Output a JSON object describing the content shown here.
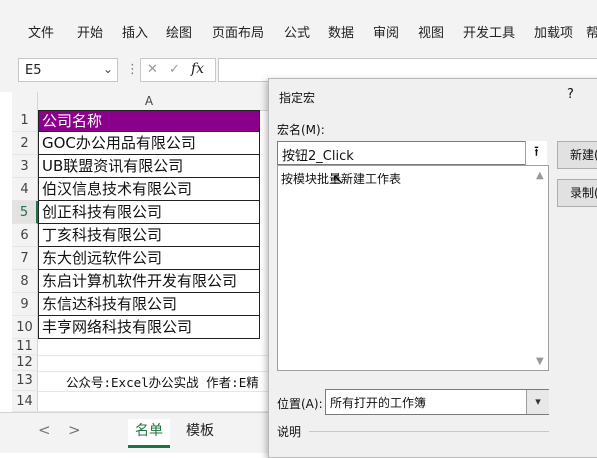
{
  "ribbon": {
    "tabs": [
      "文件",
      "开始",
      "插入",
      "绘图",
      "页面布局",
      "公式",
      "数据",
      "审阅",
      "视图",
      "开发工具",
      "加载项",
      "帮"
    ]
  },
  "formula_bar": {
    "name_box": "E5",
    "sep": "⋮",
    "cancel": "✕",
    "enter": "✓",
    "fx": "fx",
    "formula": ""
  },
  "grid": {
    "column_header": "A",
    "rows": [
      "1",
      "2",
      "3",
      "4",
      "5",
      "6",
      "7",
      "8",
      "9",
      "10",
      "11",
      "12",
      "13",
      "14"
    ],
    "selected_row": "5",
    "cells": [
      "公司名称",
      "GOC办公用品有限公司",
      "UB联盟资讯有限公司",
      "伯汉信息技术有限公司",
      "创正科技有限公司",
      "丁亥科技有限公司",
      "东大创远软件公司",
      "东启计算机软件开发有限公司",
      "东信达科技有限公司",
      "丰亨网络科技有限公司"
    ],
    "footer_text": "公众号:Excel办公实战 作者:E精"
  },
  "sheets": {
    "prev": "<",
    "next": ">",
    "tabs": [
      "名单",
      "模板"
    ],
    "active": "名单"
  },
  "dialog": {
    "title": "指定宏",
    "help": "?",
    "macro_name_label": "宏名(M):",
    "macro_name_value": "按钮2_Click",
    "upload_icon": "⭱",
    "macro_list": [
      "按模块批量新建工作表"
    ],
    "scroll_up": "▲",
    "scroll_down": "▼",
    "buttons": {
      "new": "新建(N)",
      "record": "录制(R)"
    },
    "location_label": "位置(A):",
    "location_value": "所有打开的工作簿",
    "location_arrow": "▾",
    "description_label": "说明"
  },
  "colors": {
    "header_fill": "#8b008b",
    "accent": "#217346"
  }
}
